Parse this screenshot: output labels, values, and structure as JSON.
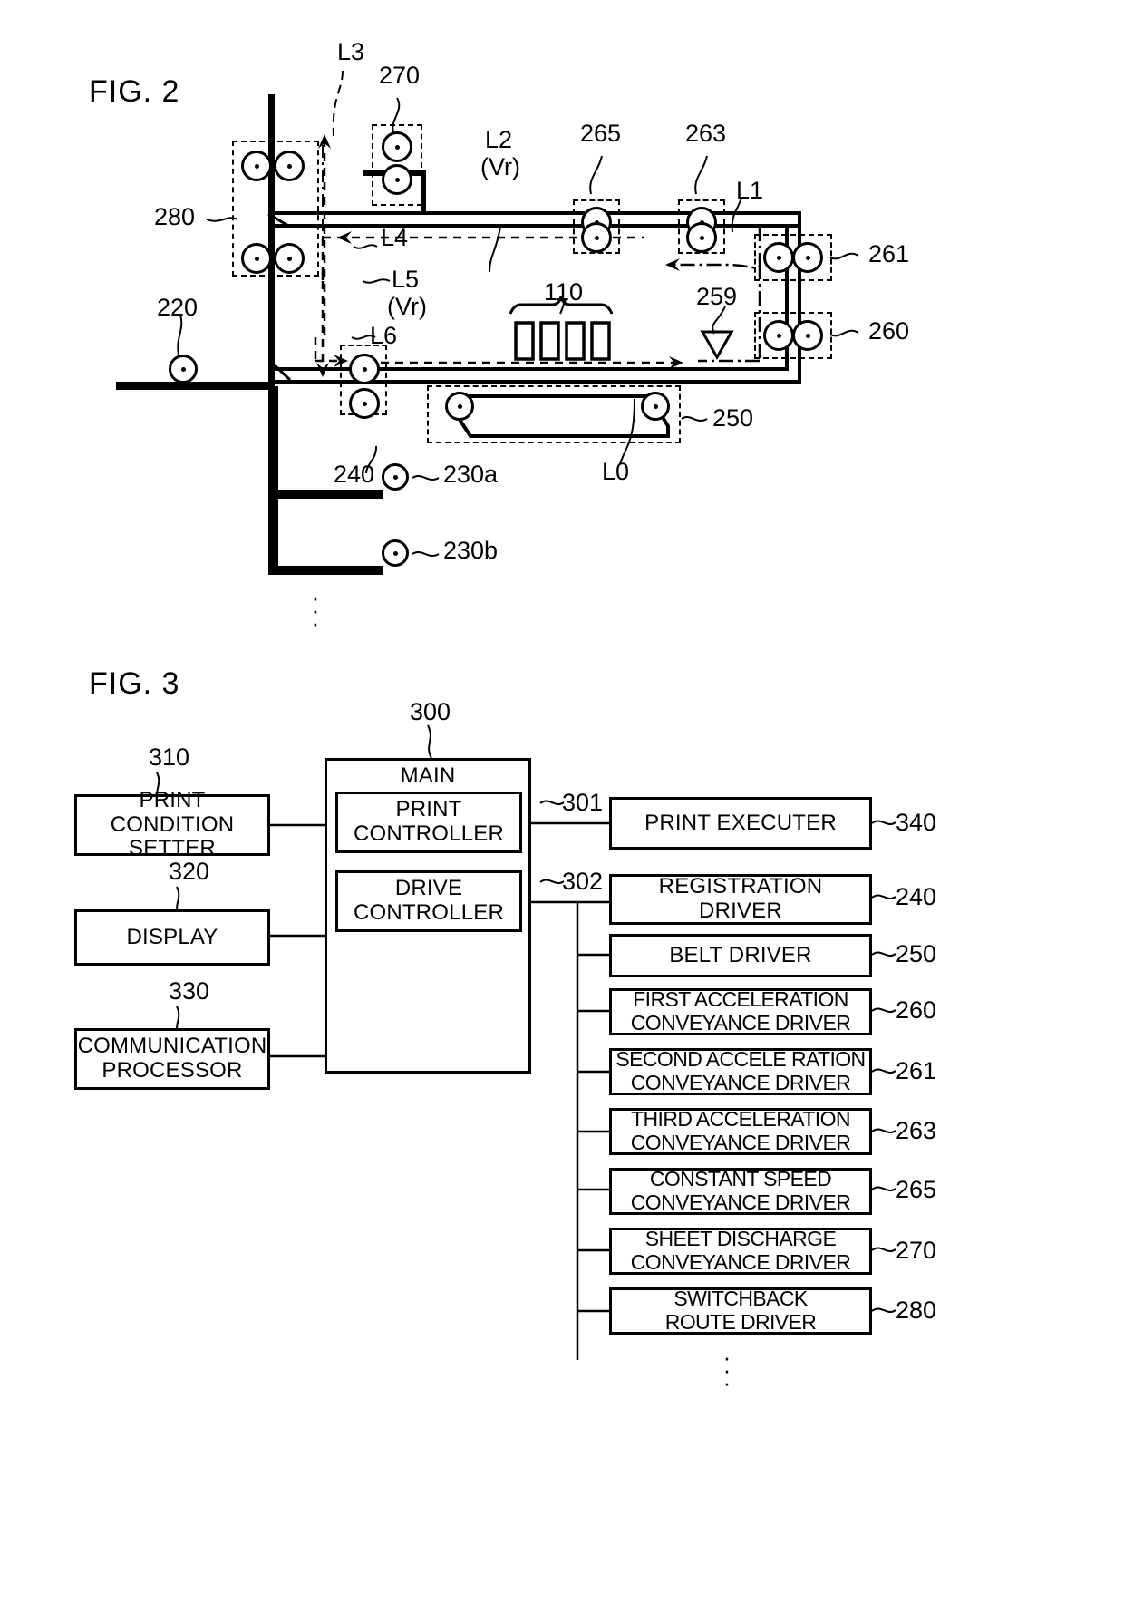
{
  "figures": {
    "fig2": {
      "title": "FIG. 2",
      "callouts": {
        "l3": "L3",
        "l2": "L2",
        "l2_sub": "(Vr)",
        "l1": "L1",
        "l4": "L4",
        "l5": "L5",
        "l5_sub": "(Vr)",
        "l6": "L6",
        "l0": "L0"
      },
      "refs": {
        "r270": "270",
        "r265": "265",
        "r263": "263",
        "r280": "280",
        "r261": "261",
        "r260": "260",
        "r259": "259",
        "r110": "110",
        "r220": "220",
        "r240": "240",
        "r230a": "230a",
        "r230b": "230b",
        "r250": "250"
      }
    },
    "fig3": {
      "title": "FIG. 3",
      "main_controller": {
        "ref": "300",
        "label": "MAIN CONTROLLER",
        "sub_blocks": [
          {
            "label": "PRINT\nCONTROLLER",
            "ref": "301"
          },
          {
            "label": "DRIVE\nCONTROLLER",
            "ref": "302"
          }
        ]
      },
      "left_blocks": [
        {
          "ref": "310",
          "label": "PRINT CONDITION\nSETTER"
        },
        {
          "ref": "320",
          "label": "DISPLAY"
        },
        {
          "ref": "330",
          "label": "COMMUNICATION\nPROCESSOR"
        }
      ],
      "right_blocks": [
        {
          "ref": "340",
          "label": "PRINT EXECUTER"
        },
        {
          "ref": "240",
          "label": "REGISTRATION\nDRIVER"
        },
        {
          "ref": "250",
          "label": "BELT DRIVER"
        },
        {
          "ref": "260",
          "label": "FIRST ACCELERATION\nCONVEYANCE DRIVER"
        },
        {
          "ref": "261",
          "label": "SECOND ACCELE RATION\nCONVEYANCE DRIVER"
        },
        {
          "ref": "263",
          "label": "THIRD ACCELERATION\nCONVEYANCE DRIVER"
        },
        {
          "ref": "265",
          "label": "CONSTANT SPEED\nCONVEYANCE DRIVER"
        },
        {
          "ref": "270",
          "label": "SHEET DISCHARGE\nCONVEYANCE DRIVER"
        },
        {
          "ref": "280",
          "label": "SWITCHBACK\nROUTE DRIVER"
        }
      ]
    }
  },
  "colors": {
    "ink": "#000000",
    "paper": "#ffffff"
  }
}
